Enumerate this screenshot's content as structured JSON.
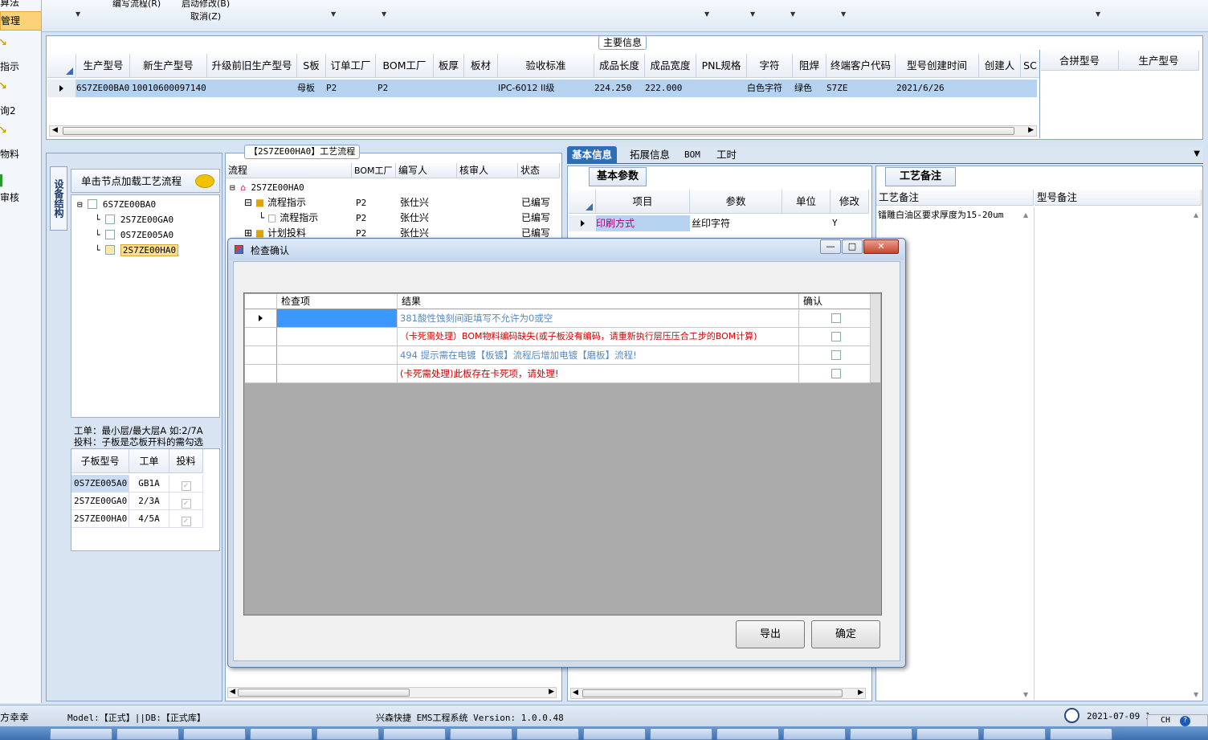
{
  "toolbar": {
    "item1": "编写流程(R)",
    "item2": "启动修改(B)",
    "item3": "取消(Z)"
  },
  "leftnav": {
    "items": [
      "算法",
      "管理",
      "指示",
      "询2",
      "物料",
      "审核"
    ]
  },
  "main_info": {
    "section_title": "主要信息",
    "columns": [
      "生产型号",
      "新生产型号",
      "升级前旧生产型号",
      "S板",
      "订单工厂",
      "BOM工厂",
      "板厚",
      "板材",
      "验收标准",
      "成品长度",
      "成品宽度",
      "PNL规格",
      "字符",
      "阻焊",
      "终端客户代码",
      "型号创建时间",
      "创建人",
      "SC"
    ],
    "row": {
      "c1": "6S7ZE00BA0",
      "c2": "10010600097140",
      "c3": "",
      "c4": "母板",
      "c5": "P2",
      "c6": "P2",
      "c7": "",
      "c8": "",
      "c9": "IPC-6012 II级",
      "c10": "224.250",
      "c11": "222.000",
      "c12": "",
      "c13": "白色字符",
      "c14": "绿色",
      "c15": "S7ZE",
      "c16": "2021/6/26"
    },
    "side_columns": [
      "合拼型号",
      "生产型号"
    ]
  },
  "tree_panel": {
    "vtab": "设备结构",
    "header": "单击节点加载工艺流程",
    "nodes": [
      "6S7ZE00BA0",
      "2S7ZE00GA0",
      "0S7ZE005A0",
      "2S7ZE00HA0"
    ],
    "note1": "工单：最小层/最大层A 如:2/7A",
    "note2": "投料：子板是芯板开料的需勾选",
    "table_headers": [
      "子板型号",
      "工单",
      "投料"
    ],
    "rows": [
      [
        "0S7ZE005A0",
        "GB1A"
      ],
      [
        "2S7ZE00GA0",
        "2/3A"
      ],
      [
        "2S7ZE00HA0",
        "4/5A"
      ]
    ]
  },
  "flow_panel": {
    "title": "【2S7ZE00HA0】工艺流程",
    "headers": [
      "流程",
      "BOM工厂",
      "编写人",
      "核审人",
      "状态"
    ],
    "rows": [
      {
        "name": "2S7ZE00HA0",
        "bom": "",
        "writer": "",
        "reviewer": "",
        "status": ""
      },
      {
        "name": "流程指示",
        "bom": "P2",
        "writer": "张仕兴",
        "reviewer": "",
        "status": "已编写"
      },
      {
        "name": "流程指示",
        "bom": "P2",
        "writer": "张仕兴",
        "reviewer": "",
        "status": "已编写"
      },
      {
        "name": "计划投料",
        "bom": "P2",
        "writer": "张仕兴",
        "reviewer": "",
        "status": "已编写"
      }
    ]
  },
  "right_tabs": [
    "基本信息",
    "拓展信息",
    "BOM",
    "工时"
  ],
  "basic_params": {
    "subtab": "基本参数",
    "headers": [
      "项目",
      "参数",
      "单位",
      "修改"
    ],
    "row": {
      "item": "印刷方式",
      "param": "丝印字符",
      "unit": "",
      "edit": "Y"
    }
  },
  "notes": {
    "subtab": "工艺备注",
    "headers": [
      "工艺备注",
      "型号备注"
    ],
    "text": "镭雕白油区要求厚度为15-20um"
  },
  "dialog": {
    "title": "检查确认",
    "headers": [
      "检查项",
      "结果",
      "确认"
    ],
    "rows": [
      {
        "item": "",
        "result": "381酸性蚀刻间距填写不允许为0或空",
        "checked": false
      },
      {
        "item": "",
        "result": "（卡死需处理）BOM物料编码缺失(或子板没有编码，请重新执行层压压合工步的BOM计算)",
        "checked": false
      },
      {
        "item": "",
        "result": "494 提示需在电镀【板镀】流程后增加电镀【磨板】流程!",
        "checked": false
      },
      {
        "item": "",
        "result": "(卡死需处理)此板存在卡死项，请处理!",
        "checked": false
      }
    ],
    "export_label": "导出",
    "ok_label": "确定"
  },
  "statusbar": {
    "user": "方幸幸",
    "model": "Model:【正式】||DB:【正式库】",
    "system": "兴森快捷 EMS工程系统 Version: 1.0.0.48",
    "date": "2021-07-09 1",
    "lang": "CH"
  },
  "colors": {
    "accent": "#2f6db5",
    "selection": "#b5d3f1",
    "error": "#d00000",
    "hint": "#5a8ac0"
  }
}
